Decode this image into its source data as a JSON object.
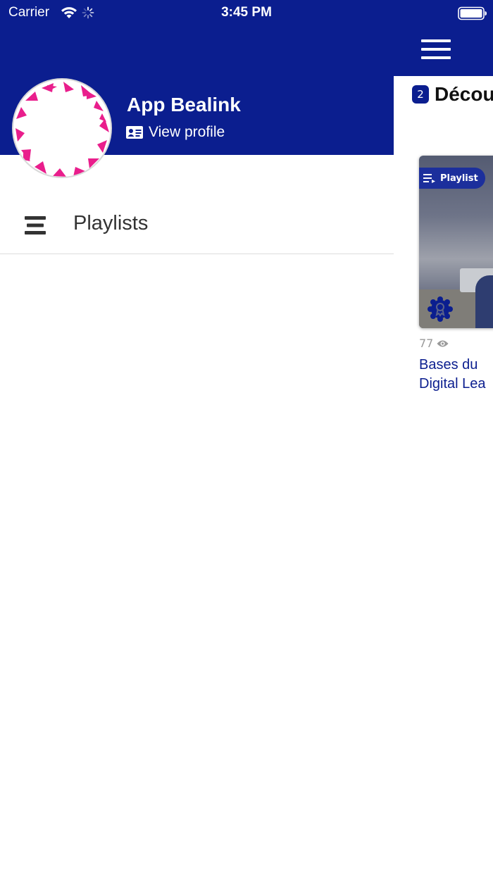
{
  "status_bar": {
    "carrier": "Carrier",
    "time": "3:45 PM",
    "icons": [
      "wifi-icon",
      "loading-spinner-icon",
      "battery-icon"
    ]
  },
  "header": {
    "menu_icon": "hamburger-icon",
    "background_color": "#0b1e8f"
  },
  "background_page": {
    "badge": "2",
    "title": "Décou",
    "card": {
      "tag": "Playlist",
      "tag_icon": "playlist-icon",
      "badge_icon": "award-badge-icon",
      "views": "77",
      "views_icon": "eye-icon",
      "title_line1": "Bases du",
      "title_line2": "Digital Lea"
    }
  },
  "drawer": {
    "profile": {
      "name": "App Bealink",
      "view_profile_label": "View profile",
      "view_profile_icon": "id-card-icon",
      "avatar_colors": [
        "#e91e8c",
        "#ffffff"
      ]
    },
    "menu": [
      {
        "label": "Playlists",
        "icon": "list-icon"
      }
    ]
  },
  "colors": {
    "brand_blue": "#0b1e8f",
    "accent_pink": "#e91e8c",
    "views_gray": "#9a9a9a"
  }
}
